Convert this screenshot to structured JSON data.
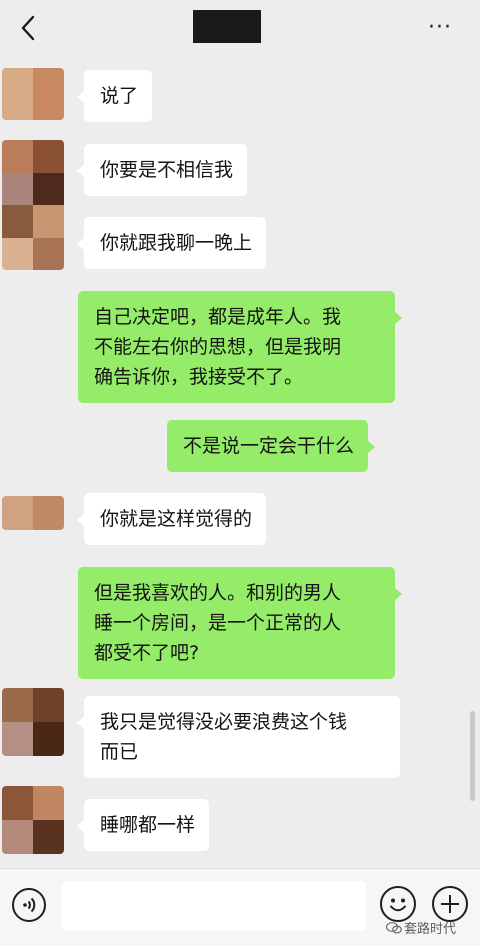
{
  "header": {
    "back_icon": "chevron-left-icon",
    "more_icon": "more-dots-icon",
    "more_glyph": "···",
    "title_redacted": true
  },
  "messages": [
    {
      "side": "in",
      "text": "说了"
    },
    {
      "side": "in",
      "text": "你要是不相信我"
    },
    {
      "side": "in",
      "text": "你就跟我聊一晚上"
    },
    {
      "side": "out",
      "text": "自己决定吧，都是成年人。我\n不能左右你的思想，但是我明\n确告诉你，我接受不了。"
    },
    {
      "side": "out",
      "text": "不是说一定会干什么"
    },
    {
      "side": "in",
      "text": "你就是这样觉得的"
    },
    {
      "side": "out",
      "text": "但是我喜欢的人。和别的男人\n睡一个房间，是一个正常的人\n都受不了吧?"
    },
    {
      "side": "in",
      "text": "我只是觉得没必要浪费这个钱\n而已"
    },
    {
      "side": "in",
      "text": "睡哪都一样"
    }
  ],
  "input_bar": {
    "voice_icon": "voice-icon",
    "input_value": "",
    "emoji_icon": "emoji-icon",
    "plus_icon": "plus-icon"
  },
  "watermark": {
    "text": "套路时代",
    "icon": "wechat-logo-icon"
  },
  "colors": {
    "background": "#ededed",
    "incoming_bubble": "#ffffff",
    "outgoing_bubble": "#95ec69"
  }
}
